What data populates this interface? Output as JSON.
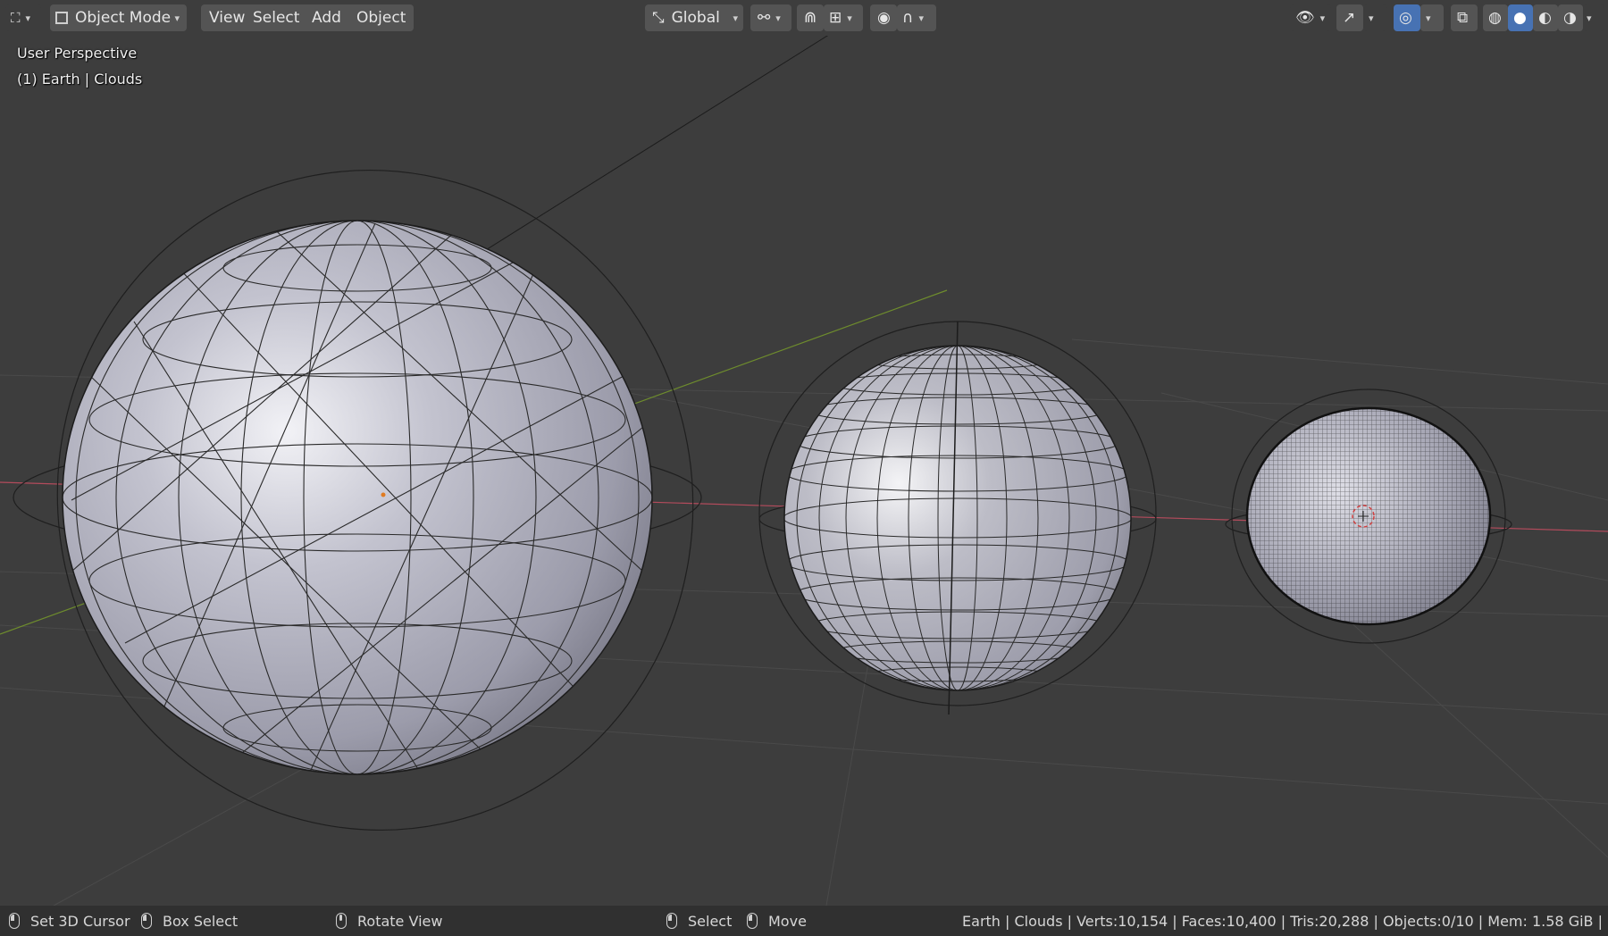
{
  "header": {
    "mode_label": "Object Mode",
    "menus": [
      "View",
      "Select",
      "Add",
      "Object"
    ],
    "orientation_label": "Global"
  },
  "viewport": {
    "view_name": "User Perspective",
    "active_object": "(1) Earth | Clouds",
    "objects": [
      "Earth (large, low-poly)",
      "Earth (medium)",
      "Earth (high-poly)"
    ]
  },
  "statusbar": {
    "hints": [
      {
        "label": "Set 3D Cursor"
      },
      {
        "label": "Box Select"
      },
      {
        "label": "Rotate View"
      },
      {
        "label": "Select"
      },
      {
        "label": "Move"
      }
    ],
    "stats": "Earth | Clouds | Verts:10,154 | Faces:10,400 | Tris:20,288 | Objects:0/10 | Mem: 1.58 GiB |"
  },
  "colors": {
    "background": "#3d3d3d",
    "header": "#3d3d3d",
    "button": "#545454",
    "active_blue": "#4772b3",
    "x_axis": "#b34b5c",
    "y_axis": "#6e8c2d",
    "sphere_fill": "#b8b8c4"
  }
}
